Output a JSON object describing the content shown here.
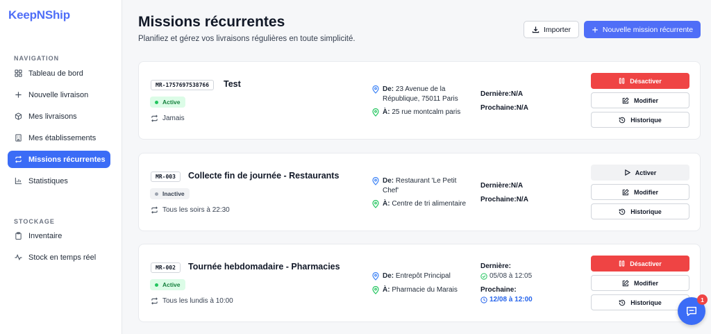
{
  "app": {
    "brand": "KeepNShip"
  },
  "sidebar": {
    "sections": [
      {
        "label": "NAVIGATION"
      },
      {
        "label": "STOCKAGE"
      }
    ],
    "items": [
      {
        "label": "Tableau de bord",
        "icon": "dashboard-icon"
      },
      {
        "label": "Nouvelle livraison",
        "icon": "plus-icon"
      },
      {
        "label": "Mes livraisons",
        "icon": "package-icon"
      },
      {
        "label": "Mes établissements",
        "icon": "building-icon"
      },
      {
        "label": "Missions récurrentes",
        "icon": "repeat-icon",
        "active": true
      },
      {
        "label": "Statistiques",
        "icon": "bar-chart-icon"
      },
      {
        "label": "Inventaire",
        "icon": "clipboard-icon"
      },
      {
        "label": "Stock en temps réel",
        "icon": "activity-icon"
      }
    ]
  },
  "header": {
    "title": "Missions récurrentes",
    "subtitle": "Planifiez et gérez vos livraisons régulières en toute simplicité.",
    "import_label": "Importer",
    "new_label": "Nouvelle mission récurrente"
  },
  "missions": [
    {
      "code": "MR-1757697538766",
      "title": "Test",
      "status": "Active",
      "frequency": "Jamais",
      "from_label": "De:",
      "from_line1": "23 Avenue de la",
      "from_line2": "République, 75011 Paris",
      "to_label": "À:",
      "to": "25 rue montcalm paris",
      "last_label": "Dernière:",
      "last_value": "N/A",
      "next_label": "Prochaine:",
      "next_value": "N/A",
      "toggle_label": "Désactiver",
      "edit_label": "Modifier",
      "history_label": "Historique"
    },
    {
      "code": "MR-003",
      "title": "Collecte fin de journée - Restaurants",
      "status": "Inactive",
      "frequency": "Tous les soirs à 22:30",
      "from_label": "De:",
      "from_line1": "Restaurant 'Le Petit",
      "from_line2": "Chef'",
      "to_label": "À:",
      "to": "Centre de tri alimentaire",
      "last_label": "Dernière:",
      "last_value": "N/A",
      "next_label": "Prochaine:",
      "next_value": "N/A",
      "toggle_label": "Activer",
      "edit_label": "Modifier",
      "history_label": "Historique"
    },
    {
      "code": "MR-002",
      "title": "Tournée hebdomadaire - Pharmacies",
      "status": "Active",
      "frequency": "Tous les lundis à 10:00",
      "from_label": "De:",
      "from_line1": "Entrepôt Principal",
      "to_label": "À:",
      "to": "Pharmacie du Marais",
      "last_label": "Dernière:",
      "last_value": "05/08 à 12:05",
      "next_label": "Prochaine:",
      "next_value": "12/08 à 12:00",
      "toggle_label": "Désactiver",
      "edit_label": "Modifier",
      "history_label": "Historique"
    }
  ],
  "chat": {
    "badge": "1"
  },
  "colors": {
    "accent": "#4f6ef7",
    "active_nav": "#3b6cf6",
    "danger": "#ef4444",
    "success": "#22c55e"
  }
}
